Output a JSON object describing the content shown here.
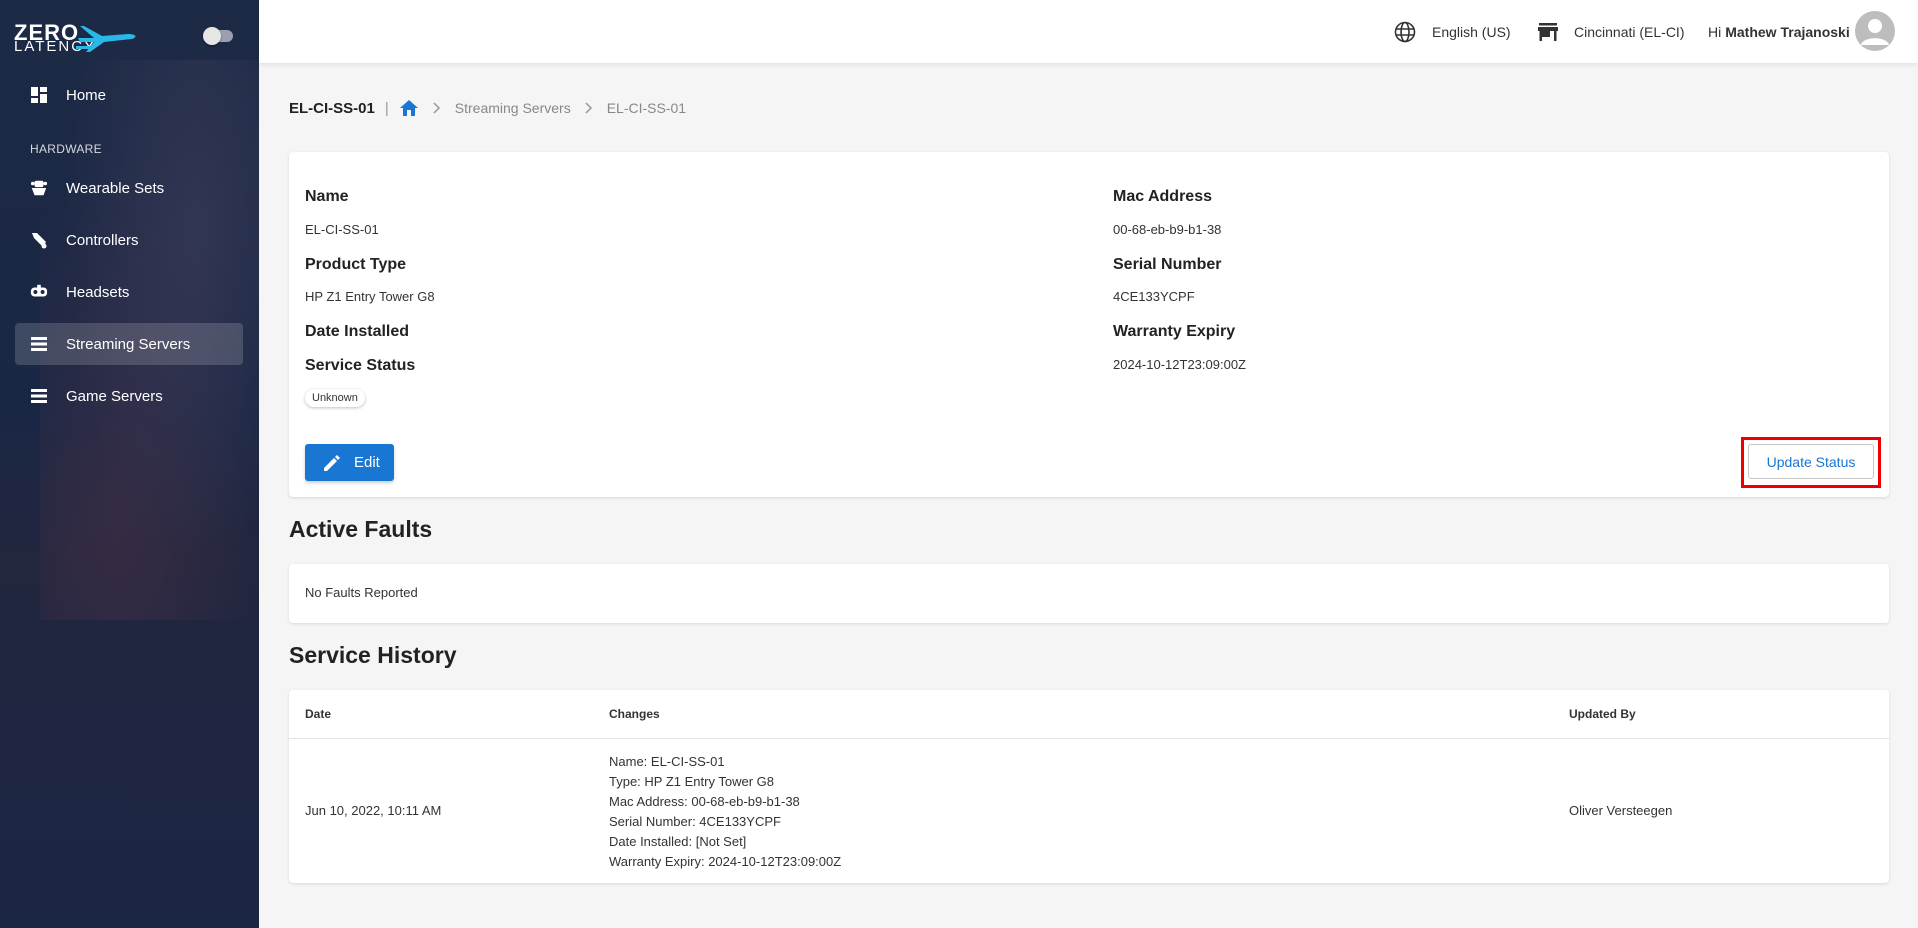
{
  "brand": {
    "line1": "ZERO",
    "line2": "LATENCY"
  },
  "sidebar": {
    "section_label": "HARDWARE",
    "items": [
      {
        "label": "Home",
        "icon": "dashboard-icon"
      },
      {
        "label": "Wearable Sets",
        "icon": "wearable-icon"
      },
      {
        "label": "Controllers",
        "icon": "controller-icon"
      },
      {
        "label": "Headsets",
        "icon": "headset-icon"
      },
      {
        "label": "Streaming Servers",
        "icon": "server-icon",
        "active": true
      },
      {
        "label": "Game Servers",
        "icon": "server-icon"
      }
    ]
  },
  "header": {
    "language": "English (US)",
    "location": "Cincinnati (EL-CI)",
    "greeting": "Hi",
    "user_name": "Mathew Trajanoski"
  },
  "breadcrumb": {
    "title": "EL-CI-SS-01",
    "separator": "|",
    "items": [
      "Streaming Servers",
      "EL-CI-SS-01"
    ]
  },
  "details": {
    "name_label": "Name",
    "name_value": "EL-CI-SS-01",
    "product_type_label": "Product Type",
    "product_type_value": "HP Z1 Entry Tower G8",
    "date_installed_label": "Date Installed",
    "service_status_label": "Service Status",
    "service_status_value": "Unknown",
    "mac_label": "Mac Address",
    "mac_value": "00-68-eb-b9-b1-38",
    "serial_label": "Serial Number",
    "serial_value": "4CE133YCPF",
    "warranty_label": "Warranty Expiry",
    "warranty_value": "2024-10-12T23:09:00Z",
    "edit_label": "Edit",
    "update_status_label": "Update Status"
  },
  "faults": {
    "title": "Active Faults",
    "empty_text": "No Faults Reported"
  },
  "history": {
    "title": "Service History",
    "columns": [
      "Date",
      "Changes",
      "Updated By"
    ],
    "rows": [
      {
        "date": "Jun 10, 2022, 10:11 AM",
        "changes": [
          "Name: EL-CI-SS-01",
          "Type: HP Z1 Entry Tower G8",
          "Mac Address: 00-68-eb-b9-b1-38",
          "Serial Number: 4CE133YCPF",
          "Date Installed: [Not Set]",
          "Warranty Expiry: 2024-10-12T23:09:00Z"
        ],
        "updated_by": "Oliver Versteegen"
      }
    ]
  },
  "colors": {
    "primary": "#1976d2",
    "sidebar": "#1d2a45",
    "highlight": "#ee0000"
  }
}
